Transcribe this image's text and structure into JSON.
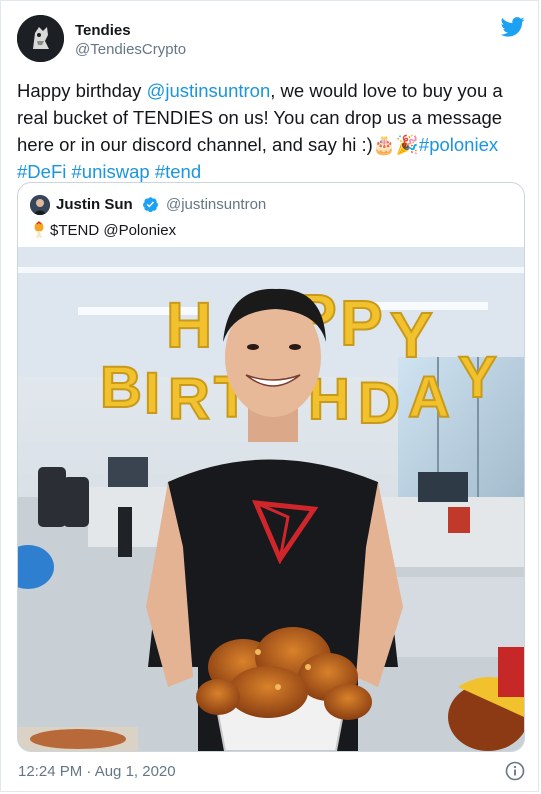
{
  "author": {
    "name": "Tendies",
    "handle": "@TendiesCrypto"
  },
  "tweet": {
    "text_before": "Happy birthday ",
    "mention": "@justinsuntron",
    "text_after": ", we would love to buy you a real bucket of TENDIES on us! You can drop us a message here or in our discord channel, and say hi :)",
    "emoji1": "🎂",
    "emoji2": "🎉",
    "hashtags": [
      "#poloniex",
      "#DeFi",
      "#uniswap",
      "#tend"
    ]
  },
  "quote": {
    "name": "Justin Sun",
    "handle": "@justinsuntron",
    "text": "$TEND @Poloniex",
    "balloon_letters": [
      "H",
      "A",
      "P",
      "P",
      "Y",
      "B",
      "I",
      "R",
      "T",
      "H",
      "D",
      "A",
      "Y"
    ]
  },
  "timestamp": "12:24 PM · Aug 1, 2020",
  "colors": {
    "link": "#1b95e0",
    "twitter_blue": "#1da1f2",
    "gold": "#f2c12e"
  },
  "icons": {
    "brand": "twitter-bird-icon",
    "verified": "verified-badge-icon",
    "info": "info-icon"
  }
}
